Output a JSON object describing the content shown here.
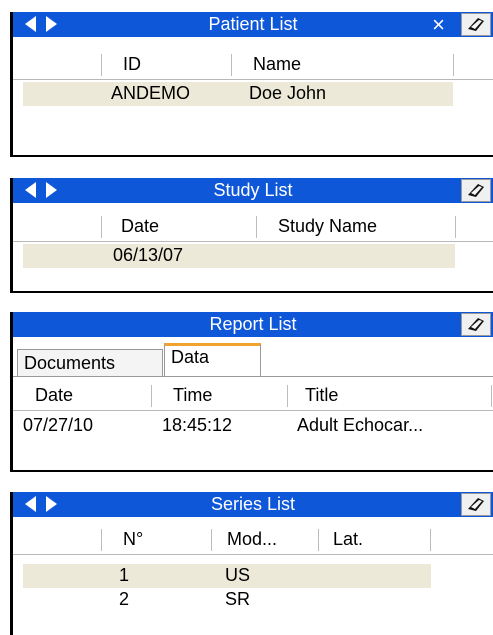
{
  "patient_list": {
    "title": "Patient List",
    "close": "×",
    "columns": [
      "ID",
      "Name"
    ],
    "rows": [
      {
        "id": "ANDEMO",
        "name": "Doe John"
      }
    ]
  },
  "study_list": {
    "title": "Study List",
    "columns": [
      "Date",
      "Study Name"
    ],
    "rows": [
      {
        "date": "06/13/07",
        "study_name": ""
      }
    ]
  },
  "report_list": {
    "title": "Report List",
    "tabs": [
      "Documents",
      "Data"
    ],
    "active_tab": "Data",
    "columns": [
      "Date",
      "Time",
      "Title"
    ],
    "rows": [
      {
        "date": "07/27/10",
        "time": "18:45:12",
        "title": "Adult Echocar..."
      }
    ]
  },
  "series_list": {
    "title": "Series List",
    "columns": [
      "N°",
      "Mod...",
      "Lat."
    ],
    "rows": [
      {
        "number": "1",
        "modality": "US",
        "laterality": ""
      },
      {
        "number": "2",
        "modality": "SR",
        "laterality": ""
      }
    ]
  },
  "colors": {
    "titlebar": "#0e57d9",
    "row_highlight": "#ece9d8",
    "active_tab_accent": "#f0a32e"
  },
  "icons": {
    "prev": "left-arrow-icon",
    "next": "right-arrow-icon",
    "close": "close-icon",
    "tool": "eraser-icon"
  }
}
